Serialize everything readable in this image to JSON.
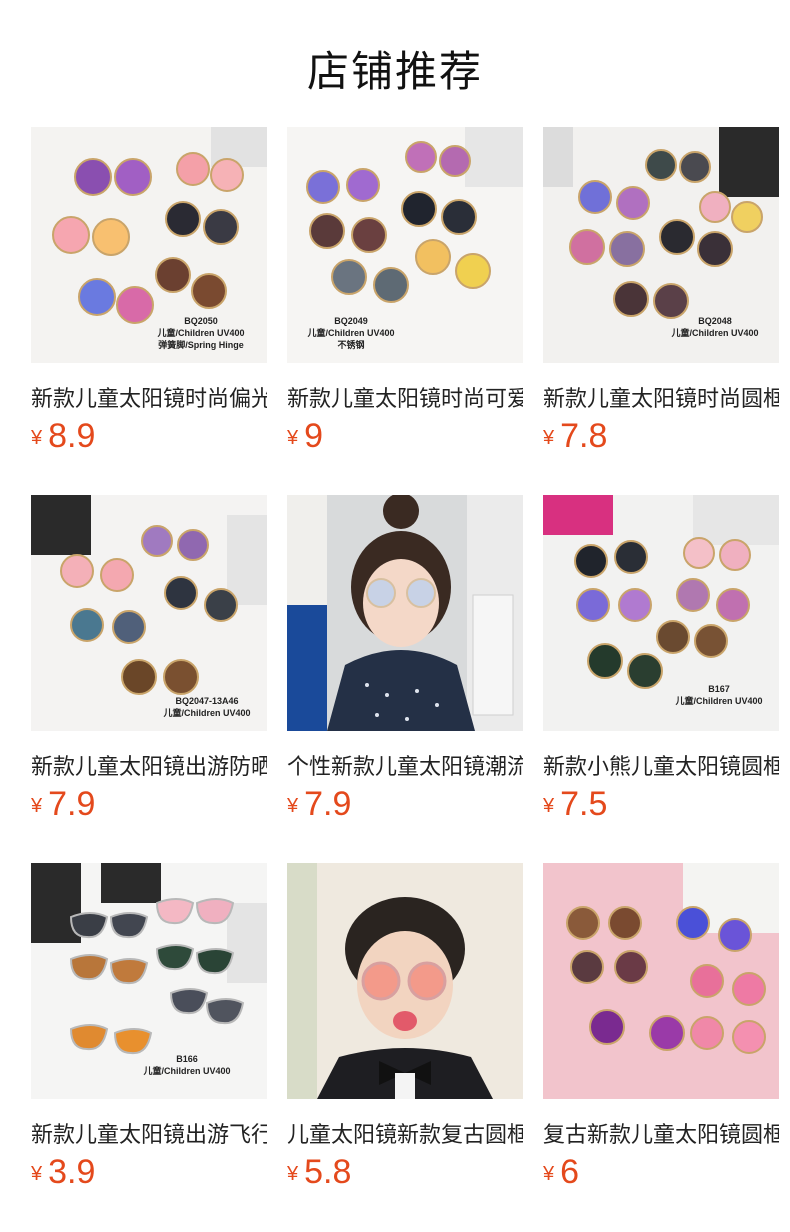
{
  "header": {
    "title": "店铺推荐"
  },
  "currency": "¥",
  "colors": {
    "price": "#e4491c",
    "title": "#111111"
  },
  "products": [
    {
      "name": "新款儿童太阳镜时尚偏光",
      "price": "8.9",
      "img_lines": [
        "BQ2050",
        "儿童/Children UV400",
        "弹簧脚/Spring Hinge"
      ]
    },
    {
      "name": "新款儿童太阳镜时尚可爱",
      "price": "9",
      "img_lines": [
        "BQ2049",
        "儿童/Children UV400",
        "不锈钢"
      ]
    },
    {
      "name": "新款儿童太阳镜时尚圆框",
      "price": "7.8",
      "img_lines": [
        "BQ2048",
        "儿童/Children UV400"
      ]
    },
    {
      "name": "新款儿童太阳镜出游防晒",
      "price": "7.9",
      "img_lines": [
        "BQ2047-13A46",
        "儿童/Children UV400"
      ]
    },
    {
      "name": "个性新款儿童太阳镜潮流",
      "price": "7.9",
      "img_lines": []
    },
    {
      "name": "新款小熊儿童太阳镜圆框",
      "price": "7.5",
      "img_lines": [
        "B167",
        "儿童/Children UV400"
      ]
    },
    {
      "name": "新款儿童太阳镜出游飞行",
      "price": "3.9",
      "img_lines": [
        "B166",
        "儿童/Children UV400"
      ]
    },
    {
      "name": "儿童太阳镜新款复古圆框",
      "price": "5.8",
      "img_lines": []
    },
    {
      "name": "复古新款儿童太阳镜圆框",
      "price": "6",
      "img_lines": []
    }
  ]
}
